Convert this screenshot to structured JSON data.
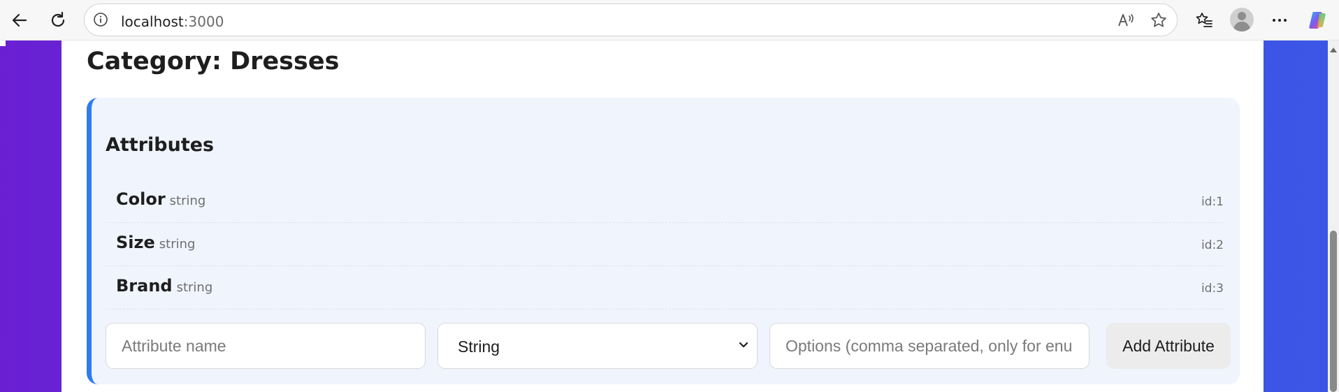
{
  "browser": {
    "url_host": "localhost",
    "url_port": ":3000",
    "icons": {
      "back": "back-arrow-icon",
      "refresh": "refresh-icon",
      "info": "site-info-icon",
      "read_aloud": "read-aloud-icon",
      "favorite": "star-icon",
      "favorites": "favorites-list-icon",
      "profile": "profile-avatar-icon",
      "more": "more-dots-icon",
      "copilot": "copilot-icon"
    }
  },
  "page": {
    "title": "Category: Dresses",
    "attributes_section": {
      "heading": "Attributes",
      "items": [
        {
          "name": "Color",
          "type": "string",
          "id": "id:1"
        },
        {
          "name": "Size",
          "type": "string",
          "id": "id:2"
        },
        {
          "name": "Brand",
          "type": "string",
          "id": "id:3"
        }
      ],
      "form": {
        "name_placeholder": "Attribute name",
        "type_value": "String",
        "options_placeholder": "Options (comma separated, only for enum)",
        "add_button": "Add Attribute"
      }
    }
  },
  "colors": {
    "accent_border": "#2f7bf1",
    "gradient_start": "#6a1fd3",
    "gradient_end": "#3b56e6",
    "panel_bg": "#f0f4fd"
  }
}
